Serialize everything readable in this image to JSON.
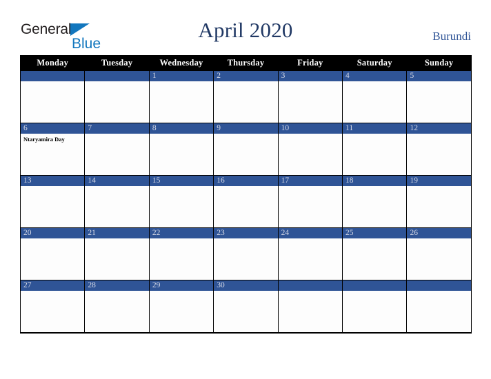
{
  "brand": {
    "word_one": "General",
    "word_two": "Blue",
    "triangle_icon": "triangle-icon",
    "primary_color": "#1277be",
    "text_color": "#231f20"
  },
  "header": {
    "title": "April 2020",
    "country": "Burundi",
    "title_color": "#203864",
    "country_color": "#2f5496"
  },
  "calendar": {
    "weekday_headers": [
      "Monday",
      "Tuesday",
      "Wednesday",
      "Thursday",
      "Friday",
      "Saturday",
      "Sunday"
    ],
    "header_bg": "#000000",
    "header_text_color": "#ffffff",
    "date_bar_color": "#2f5496",
    "date_text_color": "#d6d9e6",
    "cell_bg": "#fdfdfd",
    "grid_color": "#000000",
    "weeks": [
      [
        {
          "date": "",
          "events": []
        },
        {
          "date": "",
          "events": []
        },
        {
          "date": "1",
          "events": []
        },
        {
          "date": "2",
          "events": []
        },
        {
          "date": "3",
          "events": []
        },
        {
          "date": "4",
          "events": []
        },
        {
          "date": "5",
          "events": []
        }
      ],
      [
        {
          "date": "6",
          "events": [
            "Ntaryamira Day"
          ]
        },
        {
          "date": "7",
          "events": []
        },
        {
          "date": "8",
          "events": []
        },
        {
          "date": "9",
          "events": []
        },
        {
          "date": "10",
          "events": []
        },
        {
          "date": "11",
          "events": []
        },
        {
          "date": "12",
          "events": []
        }
      ],
      [
        {
          "date": "13",
          "events": []
        },
        {
          "date": "14",
          "events": []
        },
        {
          "date": "15",
          "events": []
        },
        {
          "date": "16",
          "events": []
        },
        {
          "date": "17",
          "events": []
        },
        {
          "date": "18",
          "events": []
        },
        {
          "date": "19",
          "events": []
        }
      ],
      [
        {
          "date": "20",
          "events": []
        },
        {
          "date": "21",
          "events": []
        },
        {
          "date": "22",
          "events": []
        },
        {
          "date": "23",
          "events": []
        },
        {
          "date": "24",
          "events": []
        },
        {
          "date": "25",
          "events": []
        },
        {
          "date": "26",
          "events": []
        }
      ],
      [
        {
          "date": "27",
          "events": []
        },
        {
          "date": "28",
          "events": []
        },
        {
          "date": "29",
          "events": []
        },
        {
          "date": "30",
          "events": []
        },
        {
          "date": "",
          "events": []
        },
        {
          "date": "",
          "events": []
        },
        {
          "date": "",
          "events": []
        }
      ]
    ]
  }
}
